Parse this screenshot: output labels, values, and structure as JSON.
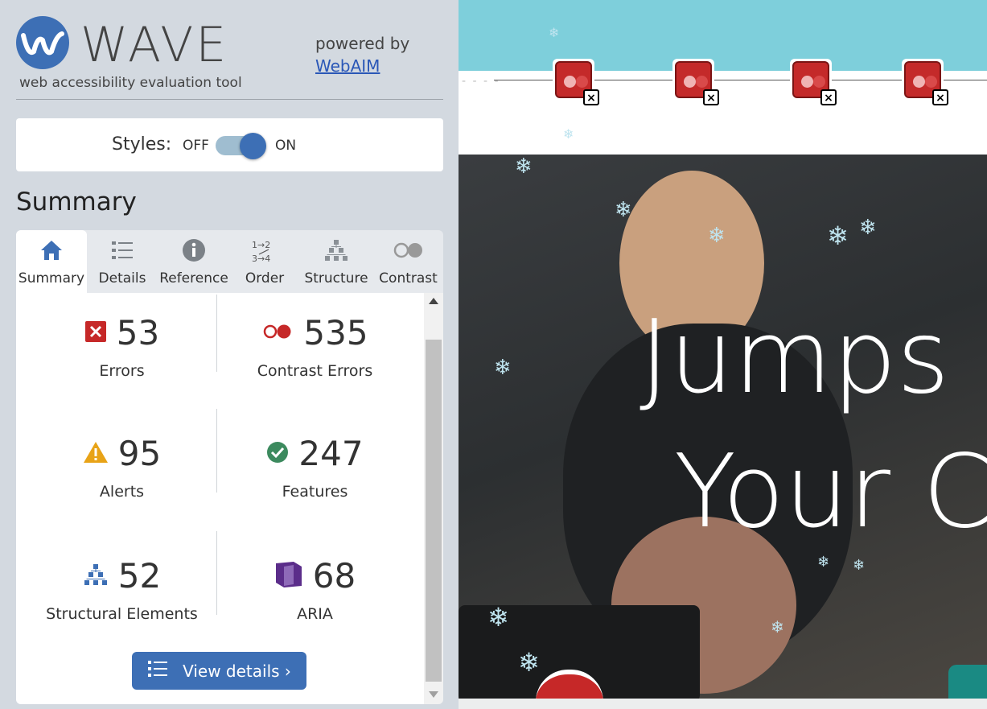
{
  "app": {
    "name": "WAVE",
    "tagline": "web accessibility evaluation tool",
    "powered_by": "powered by",
    "powered_by_link": "WebAIM",
    "accent_color": "#3d6fb5"
  },
  "styles_toggle": {
    "label": "Styles:",
    "off_label": "OFF",
    "on_label": "ON",
    "state": "on"
  },
  "summary": {
    "heading": "Summary",
    "tabs": [
      {
        "label": "Summary",
        "icon": "home-icon",
        "active": true
      },
      {
        "label": "Details",
        "icon": "list-icon",
        "active": false
      },
      {
        "label": "Reference",
        "icon": "info-icon",
        "active": false
      },
      {
        "label": "Order",
        "icon": "order-icon",
        "active": false
      },
      {
        "label": "Structure",
        "icon": "structure-icon",
        "active": false
      },
      {
        "label": "Contrast",
        "icon": "contrast-icon",
        "active": false
      }
    ],
    "counts": [
      {
        "label": "Errors",
        "value": "53",
        "icon": "error-icon",
        "color": "#c62828"
      },
      {
        "label": "Contrast Errors",
        "value": "535",
        "icon": "contrast-error-icon",
        "color": "#c62828"
      },
      {
        "label": "Alerts",
        "value": "95",
        "icon": "alert-icon",
        "color": "#e8a317"
      },
      {
        "label": "Features",
        "value": "247",
        "icon": "feature-icon",
        "color": "#3c8a5e"
      },
      {
        "label": "Structural Elements",
        "value": "52",
        "icon": "structure-icon",
        "color": "#3d6fb5"
      },
      {
        "label": "ARIA",
        "value": "68",
        "icon": "aria-icon",
        "color": "#5b2d8a"
      }
    ],
    "view_details": "View details ›"
  },
  "preview": {
    "hero_line1": "Jumps",
    "hero_line2": "Your C",
    "error_badge_count": 4
  }
}
